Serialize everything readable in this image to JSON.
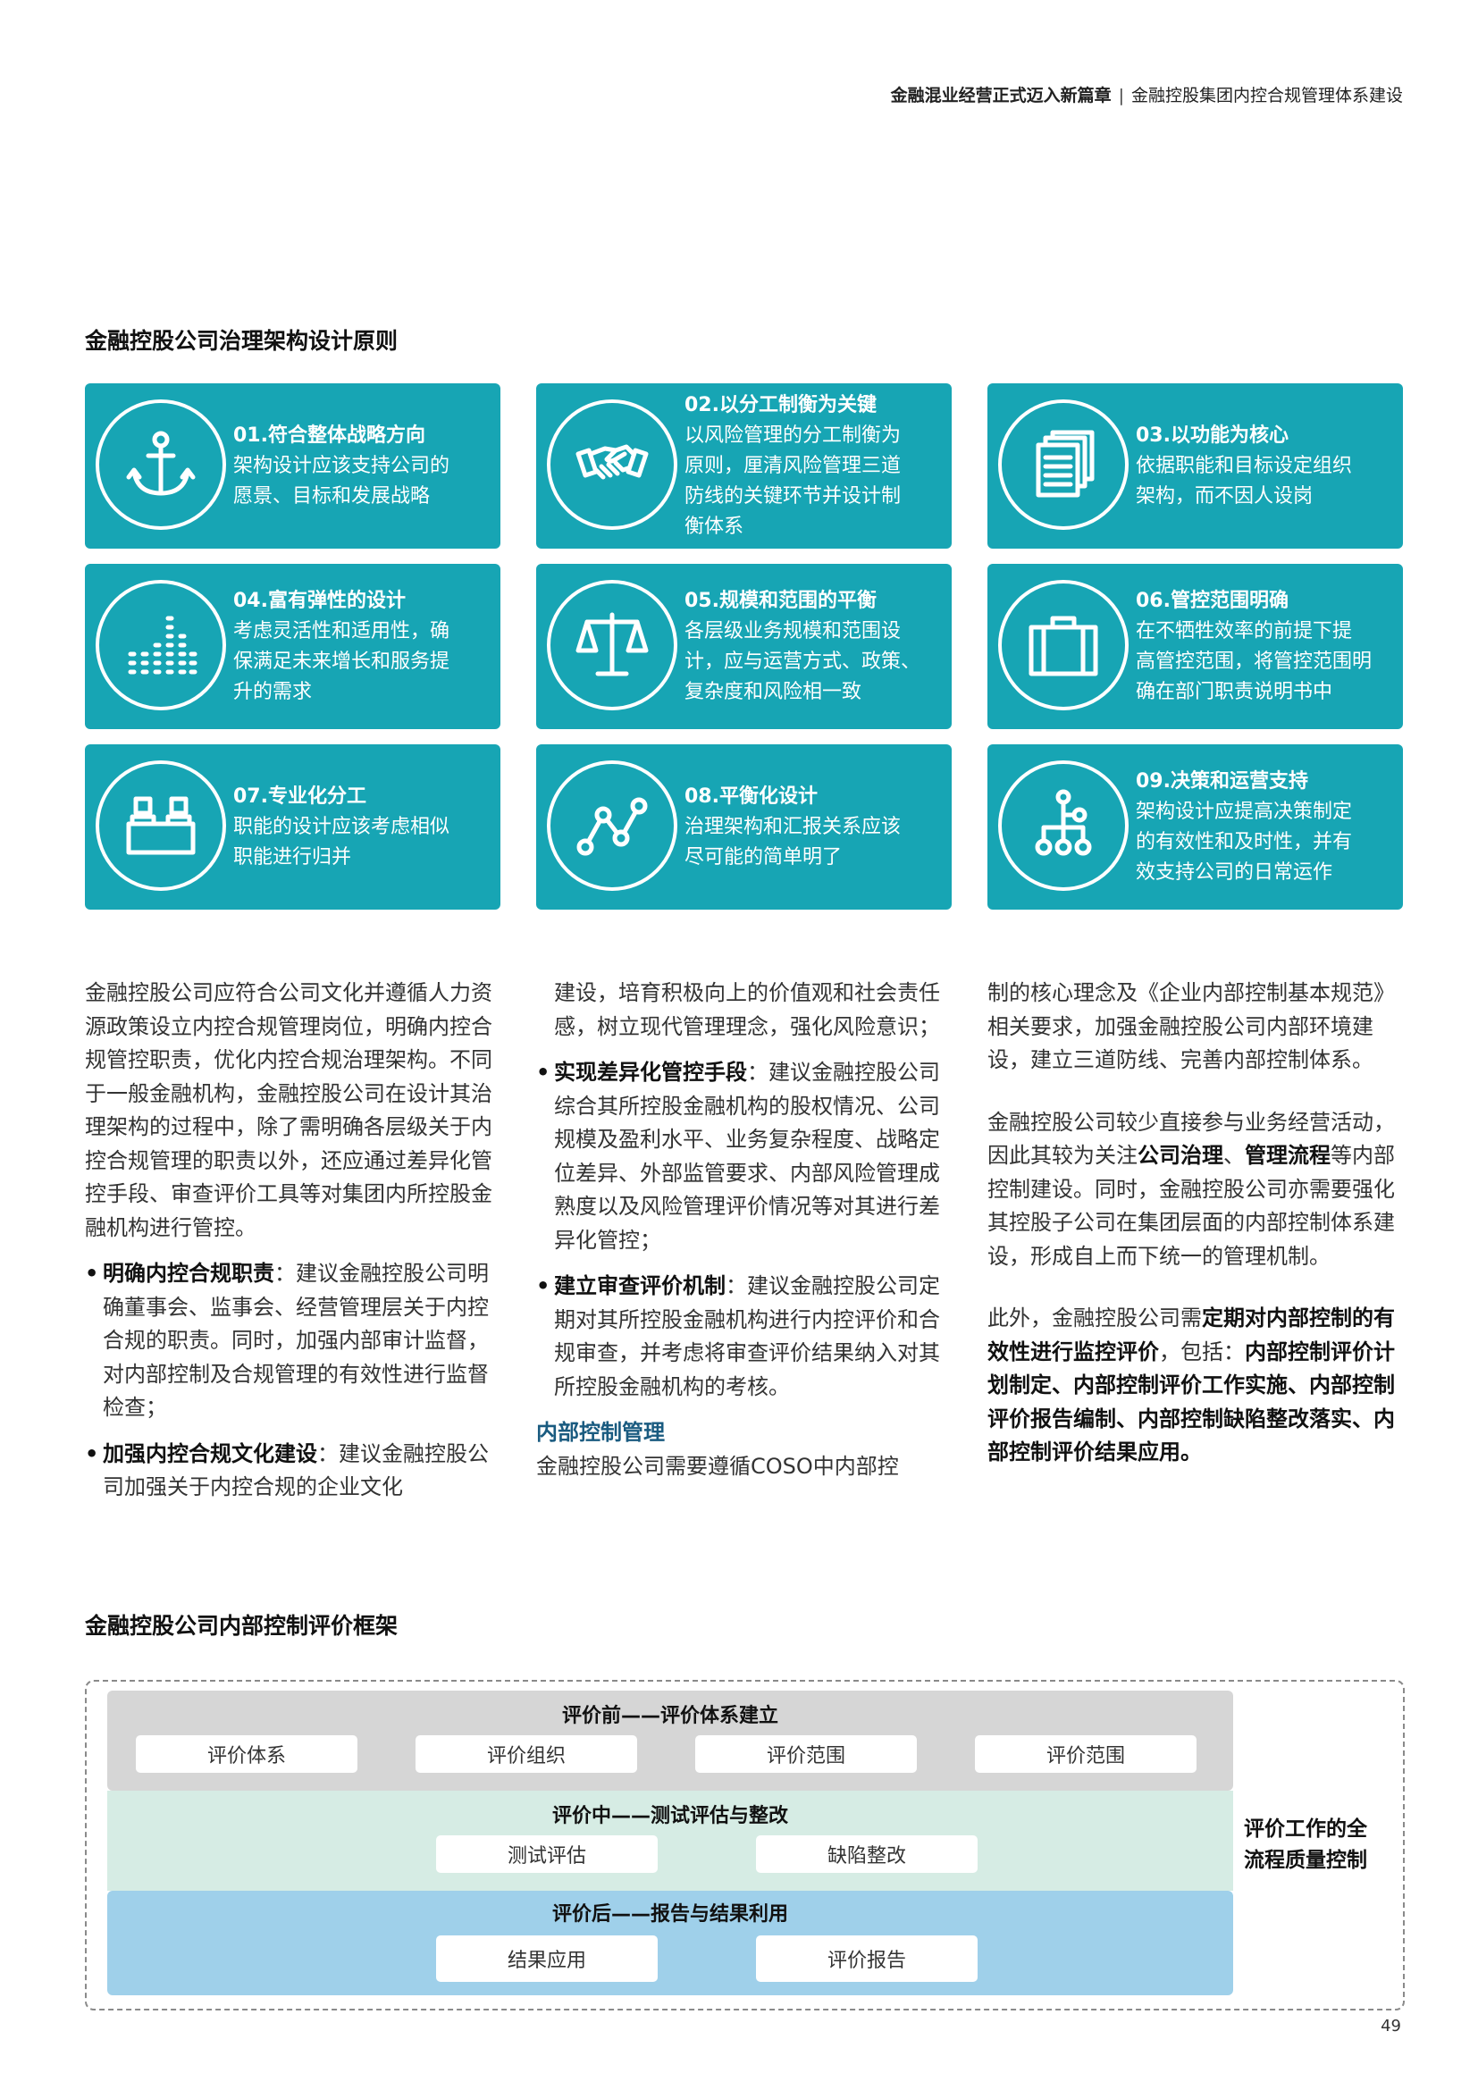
{
  "header": {
    "bold": "金融混业经营正式迈入新篇章",
    "sep": "|",
    "normal": "金融控股集团内控合规管理体系建设"
  },
  "section1": {
    "title": "金融控股公司治理架构设计原则"
  },
  "cards": [
    {
      "icon": "anchor-icon",
      "title": "01.符合整体战略方向",
      "desc": [
        "架构设计应该支持公司的",
        "愿景、目标和发展战略"
      ]
    },
    {
      "icon": "handshake-icon",
      "title": "02.以分工制衡为关键",
      "desc": [
        "以风险管理的分工制衡为",
        "原则，厘清风险管理三道",
        "防线的关键环节并设计制",
        "衡体系"
      ]
    },
    {
      "icon": "documents-icon",
      "title": "03.以功能为核心",
      "desc": [
        "依据职能和目标设定组织",
        "架构，而不因人设岗"
      ]
    },
    {
      "icon": "bar-levels-icon",
      "title": "04.富有弹性的设计",
      "desc": [
        "考虑灵活性和适用性，确",
        "保满足未来增长和服务提",
        "升的需求"
      ]
    },
    {
      "icon": "scale-icon",
      "title": "05.规模和范围的平衡",
      "desc": [
        "各层级业务规模和范围设",
        "计，应与运营方式、政策、",
        "复杂度和风险相一致"
      ]
    },
    {
      "icon": "briefcase-icon",
      "title": "06.管控范围明确",
      "desc": [
        "在不牺牲效率的前提下提",
        "高管控范围，将管控范围明",
        "确在部门职责说明书中"
      ]
    },
    {
      "icon": "people-desk-icon",
      "title": "07.专业化分工",
      "desc": [
        "职能的设计应该考虑相似",
        "职能进行归并"
      ]
    },
    {
      "icon": "line-graph-icon",
      "title": "08.平衡化设计",
      "desc": [
        "治理架构和汇报关系应该",
        "尽可能的简单明了"
      ]
    },
    {
      "icon": "hierarchy-icon",
      "title": "09.决策和运营支持",
      "desc": [
        "架构设计应提高决策制定",
        "的有效性和及时性，并有",
        "效支持公司的日常运作"
      ]
    }
  ],
  "body": {
    "c1_p1": "金融控股公司应符合公司文化并遵循人力资源政策设立内控合规管理岗位，明确内控合规管控职责，优化内控合规治理架构。不同于一般金融机构，金融控股公司在设计其治理架构的过程中，除了需明确各层级关于内控合规管理的职责以外，还应通过差异化管控手段、审查评价工具等对集团内所控股金融机构进行管控。",
    "b1_bold": "明确内控合规职责",
    "b1_text": "：建议金融控股公司明确董事会、监事会、经营管理层关于内控合规的职责。同时，加强内部审计监督，对内部控制及合规管理的有效性进行监督检查；",
    "b2_bold": "加强内控合规文化建设",
    "b2_text": "：建议金融控股公司加强关于内控合规的企业文化",
    "c2_p1": "建设，培育积极向上的价值观和社会责任感，树立现代管理理念，强化风险意识；",
    "b3_bold": "实现差异化管控手段",
    "b3_text": "：建议金融控股公司综合其所控股金融机构的股权情况、公司规模及盈利水平、业务复杂程度、战略定位差异、外部监管要求、内部风险管理成熟度以及风险管理评价情况等对其进行差异化管控；",
    "b4_bold": "建立审查评价机制",
    "b4_text": "：建议金融控股公司定期对其所控股金融机构进行内控评价和合规审查，并考虑将审查评价结果纳入对其所控股金融机构的考核。",
    "subhead": "内部控制管理",
    "c2_p2": "金融控股公司需要遵循COSO中内部控",
    "c3_p1": "制的核心理念及《企业内部控制基本规范》相关要求，加强金融控股公司内部环境建设，建立三道防线、完善内部控制体系。",
    "c3_p2_a": "金融控股公司较少直接参与业务经营活动，因此其较为关注",
    "c3_p2_b1": "公司治理",
    "c3_p2_c": "、",
    "c3_p2_b2": "管理流程",
    "c3_p2_d": "等内部控制建设。同时，金融控股公司亦需要强化其控股子公司在集团层面的内部控制体系建设，形成自上而下统一的管理机制。",
    "c3_p3_a": "此外，金融控股公司需",
    "c3_p3_b": "定期对内部控制的有效性进行监控评价",
    "c3_p3_c": "，包括：",
    "c3_p3_d": "内部控制评价计划制定、内部控制评价工作实施、内部控制评价报告编制、内部控制缺陷整改落实、内部控制评价结果应用。"
  },
  "section2": {
    "title": "金融控股公司内部控制评价框架"
  },
  "framework": {
    "before": {
      "title": "评价前——评价体系建立",
      "items": [
        "评价体系",
        "评价组织",
        "评价范围",
        "评价范围"
      ]
    },
    "during": {
      "title": "评价中——测试评估与整改",
      "items": [
        "测试评估",
        "缺陷整改"
      ]
    },
    "after": {
      "title": "评价后——报告与结果利用",
      "items": [
        "结果应用",
        "评价报告"
      ]
    },
    "side_label": "评价工作的全流程质量控制",
    "colors": {
      "before": "#d6d6d6",
      "during": "#d6ece4",
      "after": "#9fd0ea"
    }
  },
  "page_number": "49"
}
